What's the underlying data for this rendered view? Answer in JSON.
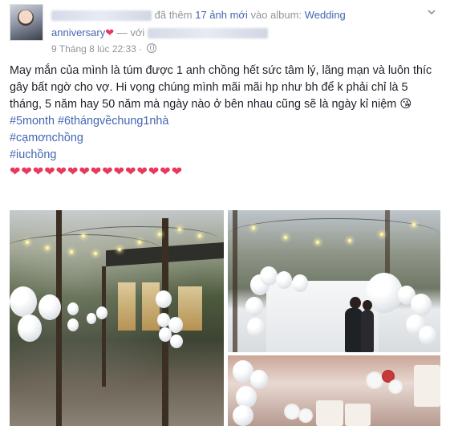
{
  "header": {
    "action_text": "đã thêm",
    "photo_count_link": "17 ảnh mới",
    "album_prefix": "vào album:",
    "album_name_part1": "Wedding",
    "album_name_part2": "anniversary",
    "with_text": "— với",
    "timestamp": "9 Tháng 8 lúc 22:33",
    "privacy_separator": "·"
  },
  "post": {
    "paragraph": "May mắn của mình là túm được 1 anh chồng hết sức tâm lý, lãng mạn và luôn thíc gây bất ngờ cho vợ. Hi vọng chúng mình mãi mãi hp như bh để k phải chỉ là 5 tháng, 5 năm hay 50 năm mà ngày nào ở bên nhau cũng sẽ là ngày kỉ niệm",
    "emoji": "😘",
    "hashtags": [
      "#5month #6thángvềchung1nhà",
      "#cạmơnchồng",
      "#iuchồng"
    ],
    "hearts": "❤❤❤❤❤❤❤❤❤❤❤❤❤❤❤",
    "album_heart": "❤"
  },
  "colors": {
    "link": "#4267b2",
    "meta": "#90949c",
    "text": "#1d2129",
    "heart": "#e8385b"
  },
  "icons": [
    "globe-icon",
    "chevron-down-icon"
  ]
}
